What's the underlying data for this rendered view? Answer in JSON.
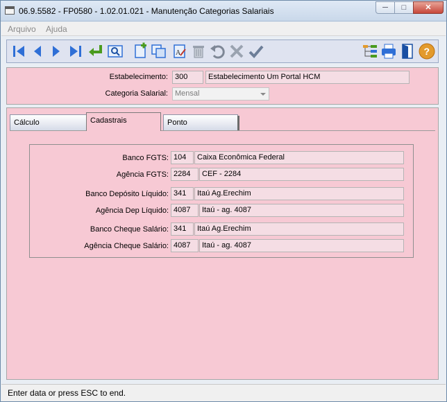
{
  "window": {
    "title": "06.9.5582 - FP0580 - 1.02.01.021 - Manutenção Categorias Salariais",
    "min_label": "─",
    "max_label": "□",
    "close_label": "✕"
  },
  "menu": {
    "items": [
      "Arquivo",
      "Ajuda"
    ]
  },
  "toolbar": {
    "buttons": [
      "first-record",
      "previous-record",
      "next-record",
      "last-record",
      "go-to",
      "search",
      "add-record",
      "copy-record",
      "edit-record",
      "delete-record",
      "undo",
      "cancel",
      "save",
      "hierarchy",
      "print",
      "exit",
      "help"
    ]
  },
  "header": {
    "estab_label": "Estabelecimento:",
    "estab_code": "300",
    "estab_name": "Estabelecimento Um Portal HCM",
    "categoria_label": "Categoria Salarial:",
    "categoria_value": "Mensal"
  },
  "tabs": [
    "Cálculo",
    "Cadastrais",
    "Ponto"
  ],
  "active_tab": "Cadastrais",
  "bank": {
    "banco_fgts_label": "Banco FGTS:",
    "banco_fgts_code": "104",
    "banco_fgts_name": "Caixa Econômica Federal",
    "agencia_fgts_label": "Agência FGTS:",
    "agencia_fgts_code": "2284",
    "agencia_fgts_name": "CEF - 2284",
    "banco_dep_label": "Banco Depósito Líquido:",
    "banco_dep_code": "341",
    "banco_dep_name": "Itaú Ag.Erechim",
    "agencia_dep_label": "Agência Dep Líquido:",
    "agencia_dep_code": "4087",
    "agencia_dep_name": "Itaú - ag. 4087",
    "banco_cheque_label": "Banco Cheque Salário:",
    "banco_cheque_code": "341",
    "banco_cheque_name": "Itaú Ag.Erechim",
    "agencia_cheque_label": "Agência Cheque Salário:",
    "agencia_cheque_code": "4087",
    "agencia_cheque_name": "Itaú - ag. 4087"
  },
  "status": {
    "text": "Enter data or press ESC to end."
  },
  "colors": {
    "form_bg": "#f7c9d4",
    "field_bg": "#f5dde4",
    "toolbar_bg": "#dfe3f0",
    "icon_blue": "#2f6fd6",
    "icon_green": "#4a9b1e"
  }
}
